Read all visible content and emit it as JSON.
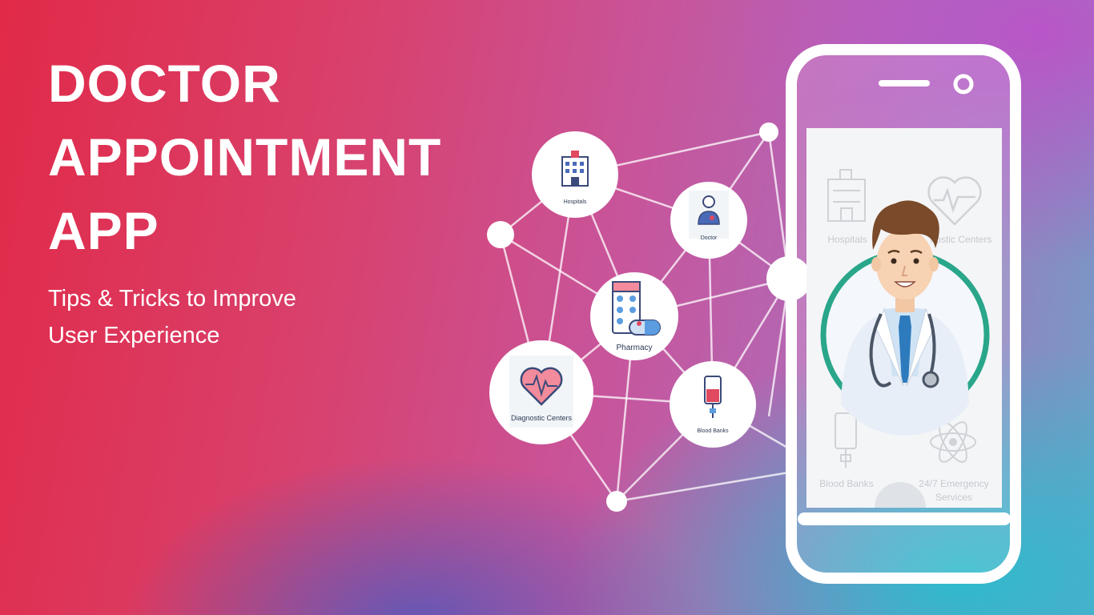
{
  "headline": {
    "line1": "DOCTOR",
    "line2": "APPOINTMENT",
    "line3": "APP"
  },
  "subline": {
    "line1": "Tips & Tricks to Improve",
    "line2": "User Experience"
  },
  "nodes": {
    "hospitals": "Hospitals",
    "doctor": "Doctor",
    "pharmacy": "Pharmacy",
    "diagnostic": "Diagnostic Centers",
    "blood_banks": "Blood Banks"
  },
  "phone_screen": {
    "hospitals": "Hospitals",
    "diagnostic": "nostic Centers",
    "blood_banks": "Blood Banks",
    "emergency_line1": "24/7 Emergency",
    "emergency_line2": "Services"
  },
  "colors": {
    "accent_teal": "#2aa68a",
    "icon_navy": "#3b4a7a",
    "icon_red": "#e0495f",
    "bg_red": "#e12a48",
    "bg_teal": "#28bece"
  },
  "icons": [
    "hospital-icon",
    "doctor-icon",
    "pharmacy-icon",
    "heart-monitor-icon",
    "blood-bag-icon",
    "atom-icon"
  ]
}
